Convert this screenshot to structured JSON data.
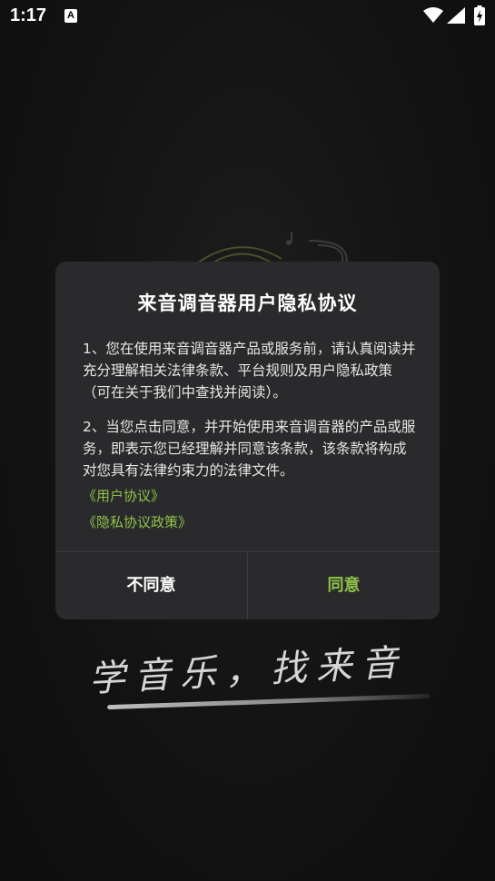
{
  "status_bar": {
    "time": "1:17",
    "notification_icon": "A"
  },
  "dialog": {
    "title": "来音调音器用户隐私协议",
    "paragraph1": "1、您在使用来音调音器产品或服务前，请认真阅读并充分理解相关法律条款、平台规则及用户隐私政策（可在关于我们中查找并阅读）。",
    "paragraph2": "2、当您点击同意，并开始使用来音调音器的产品或服务，即表示您已经理解并同意该条款，该条款将构成对您具有法律约束力的法律文件。",
    "link_user_agreement": "《用户协议》",
    "link_privacy_policy": "《隐私协议政策》",
    "disagree_label": "不同意",
    "agree_label": "同意"
  },
  "splash": {
    "slogan": "学音乐，找来音"
  },
  "colors": {
    "accent": "#8ec24a",
    "dialog_bg": "#2a2a2c",
    "background": "#131313"
  }
}
